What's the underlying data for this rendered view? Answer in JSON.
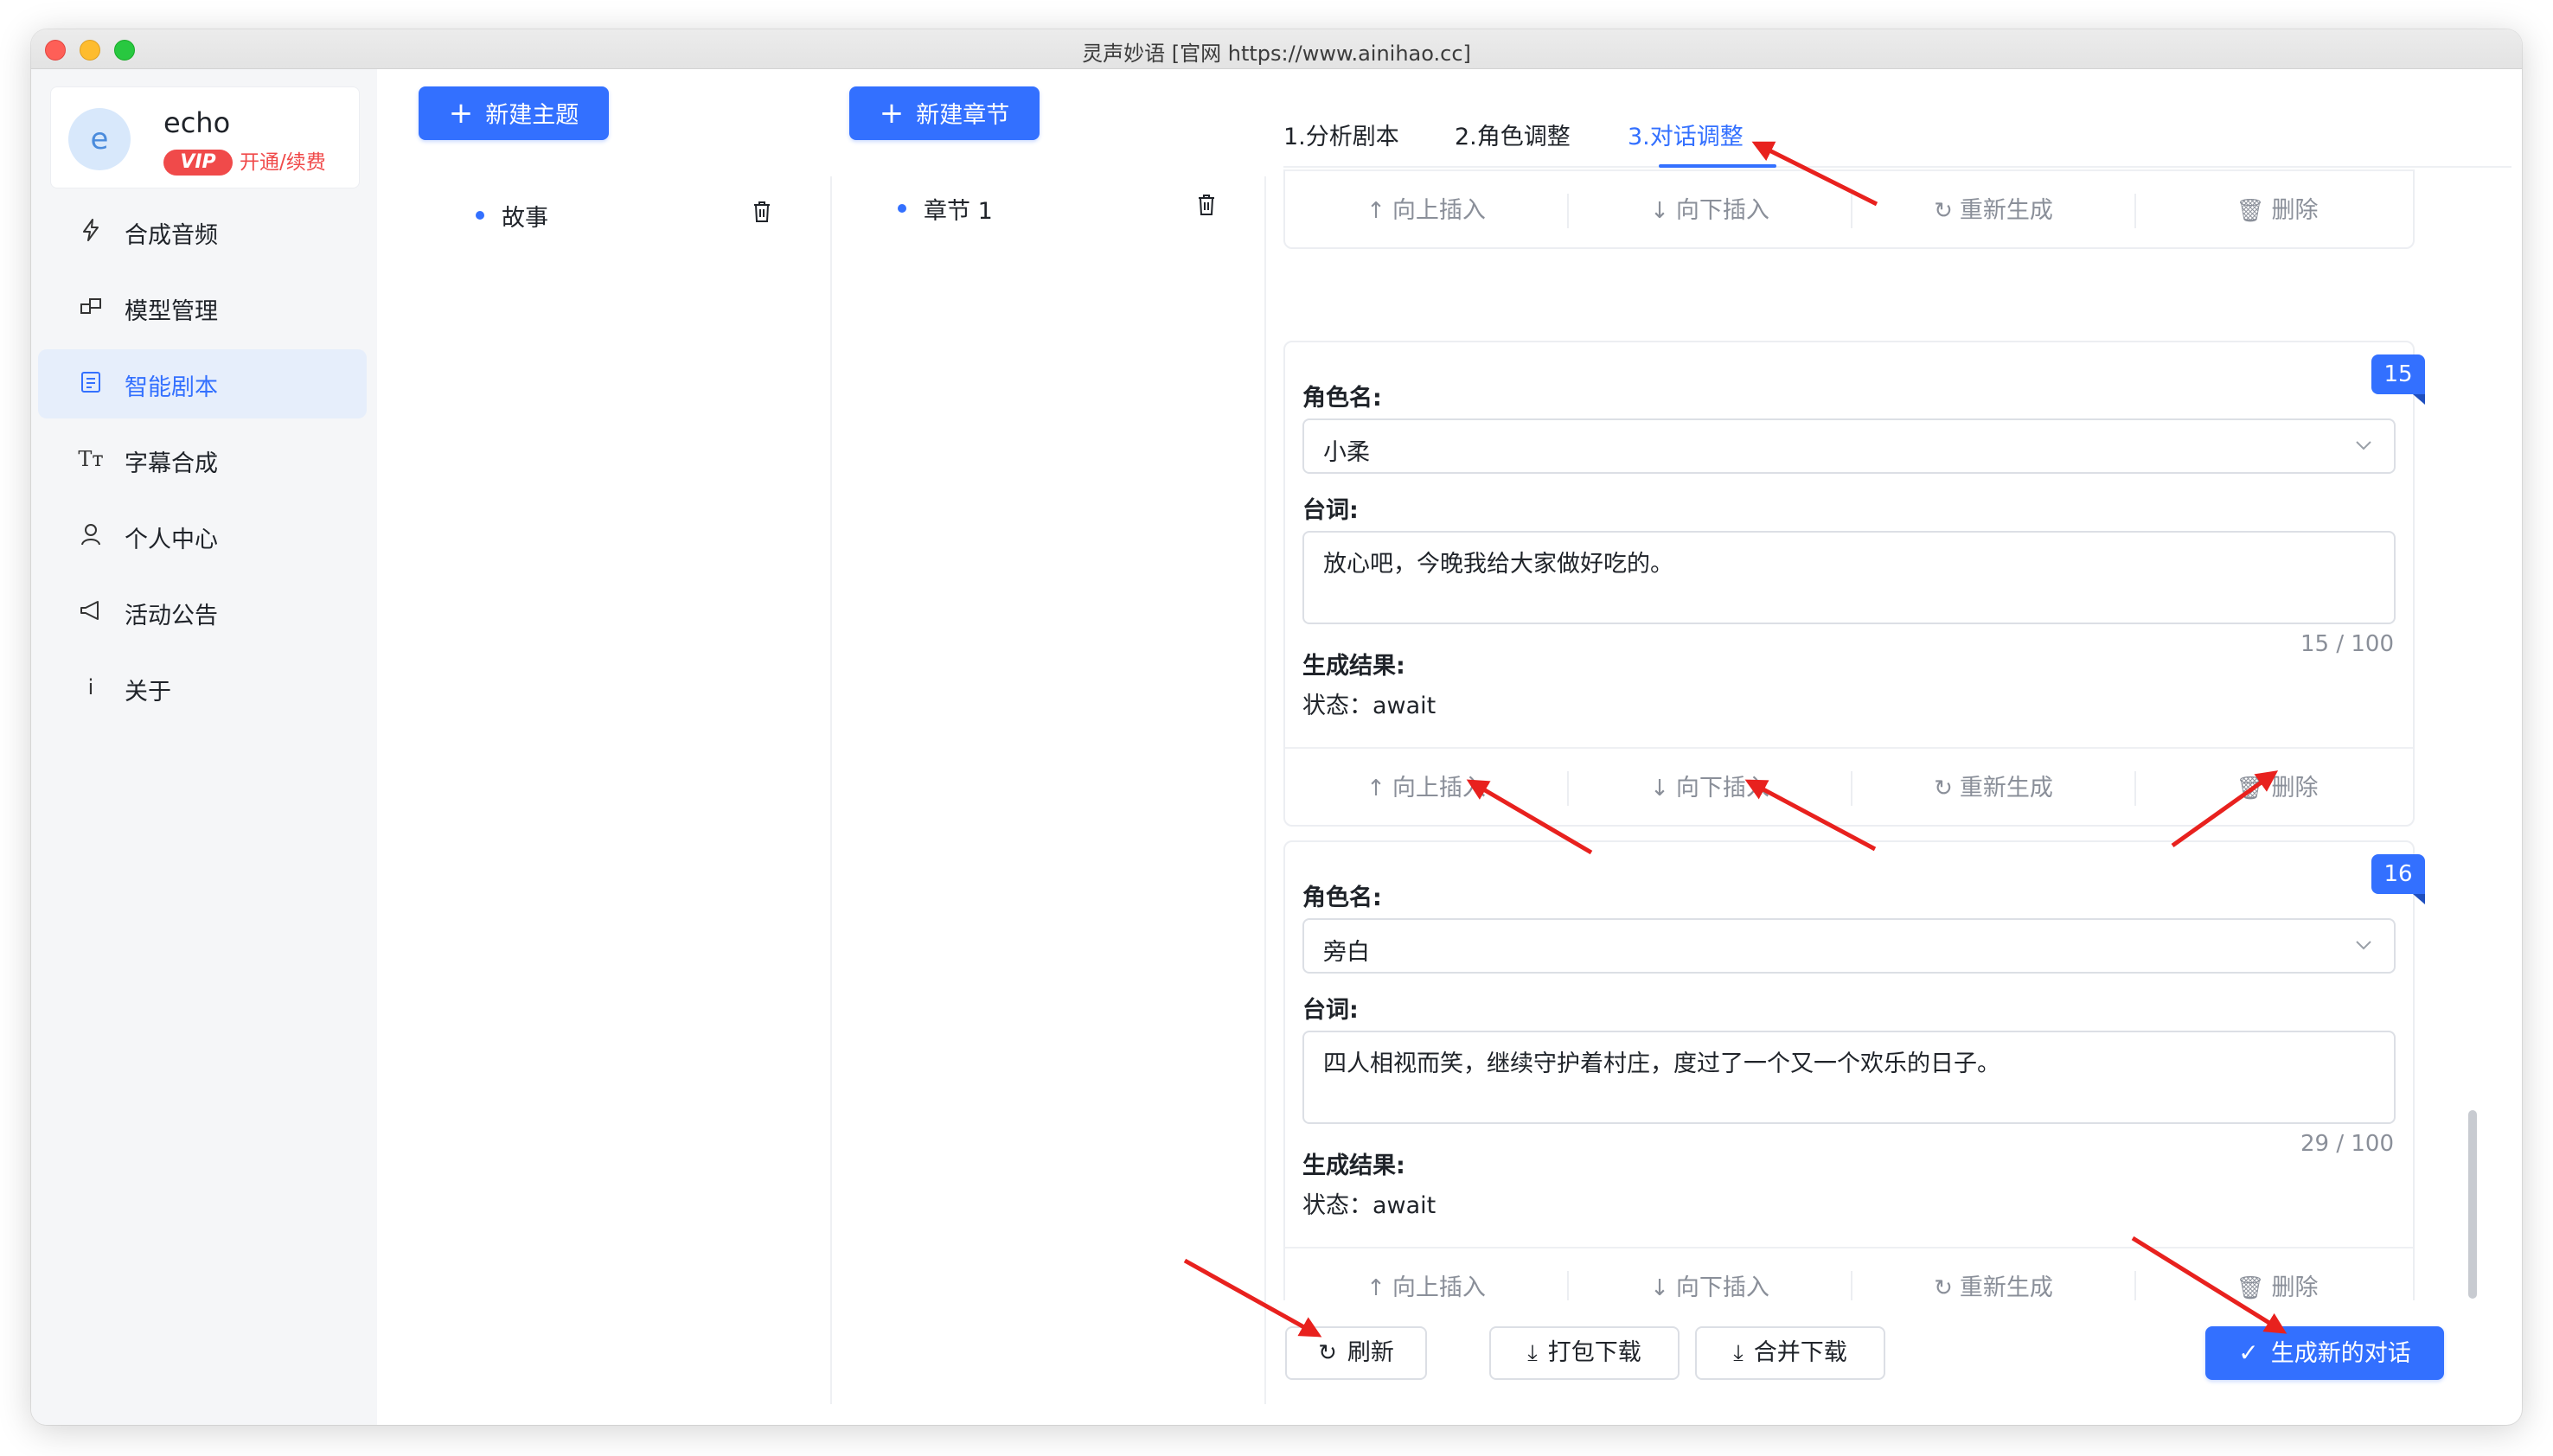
{
  "window": {
    "title": "灵声妙语 [官网 https://www.ainihao.cc]"
  },
  "user": {
    "avatar_letter": "e",
    "name": "echo",
    "vip_badge": "VIP",
    "vip_link": "开通/续费"
  },
  "sidebar": {
    "items": [
      {
        "icon": "lightning-icon",
        "label": "合成音频"
      },
      {
        "icon": "model-icon",
        "label": "模型管理"
      },
      {
        "icon": "script-icon",
        "label": "智能剧本",
        "active": true
      },
      {
        "icon": "text-icon",
        "label": "字幕合成"
      },
      {
        "icon": "user-icon",
        "label": "个人中心"
      },
      {
        "icon": "megaphone-icon",
        "label": "活动公告"
      },
      {
        "icon": "info-icon",
        "label": "关于"
      }
    ]
  },
  "topics": {
    "new_button": "新建主题",
    "items": [
      "故事"
    ]
  },
  "chapters": {
    "new_button": "新建章节",
    "items": [
      "章节 1"
    ]
  },
  "tabs": [
    "1.分析剧本",
    "2.角色调整",
    "3.对话调整"
  ],
  "active_tab": 2,
  "dialog": {
    "role_label": "角色名:",
    "line_label": "台词:",
    "result_label": "生成结果:",
    "actions": [
      "向上插入",
      "向下插入",
      "重新生成",
      "删除"
    ],
    "cards": [
      {
        "number": "15",
        "role": "小柔",
        "line": "放心吧，今晚我给大家做好吃的。",
        "counter": "15 / 100",
        "status": "状态：await"
      },
      {
        "number": "16",
        "role": "旁白",
        "line": "四人相视而笑，继续守护着村庄，度过了一个又一个欢乐的日子。",
        "counter": "29 / 100",
        "status": "状态：await"
      }
    ]
  },
  "footer": {
    "refresh": "刷新",
    "pack_download": "打包下载",
    "merge_download": "合并下载",
    "generate": "生成新的对话"
  },
  "colors": {
    "accent": "#3370ff",
    "vip": "#f04a4a",
    "annotation_arrow": "#e8211e"
  }
}
